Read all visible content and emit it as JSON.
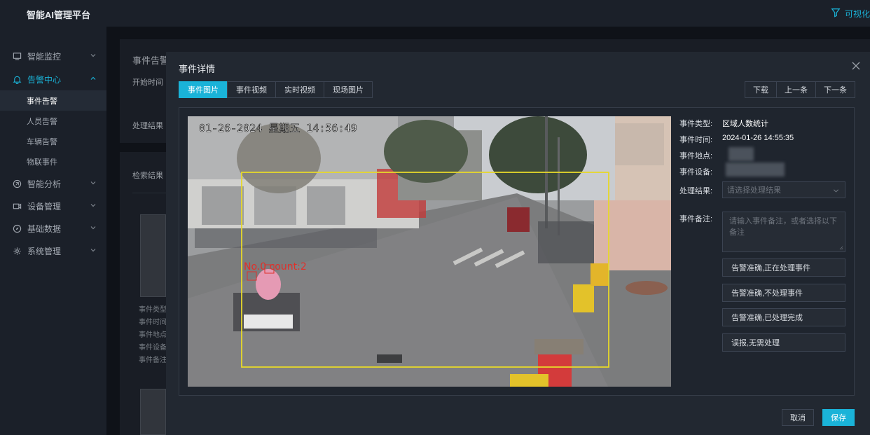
{
  "app": {
    "title": "智能AI管理平台",
    "top_right_label": "可视化"
  },
  "sidebar": {
    "items": [
      {
        "label": "智能监控",
        "icon": "monitor-icon"
      },
      {
        "label": "告警中心",
        "icon": "bell-icon"
      },
      {
        "label": "智能分析",
        "icon": "analysis-icon"
      },
      {
        "label": "设备管理",
        "icon": "camera-icon"
      },
      {
        "label": "基础数据",
        "icon": "compass-icon"
      },
      {
        "label": "系统管理",
        "icon": "gear-icon"
      }
    ],
    "sub_items": [
      "事件告警",
      "人员告警",
      "车辆告警",
      "物联事件"
    ]
  },
  "background": {
    "panel_title": "事件告警",
    "start_time_label": "开始时间",
    "result_label": "处理结果",
    "search_result_label": "检索结果",
    "card_fields": [
      "事件类型:",
      "事件时间:",
      "事件地点:",
      "事件设备:",
      "事件备注:"
    ]
  },
  "modal": {
    "title": "事件详情",
    "tabs": [
      "事件图片",
      "事件视频",
      "实时视频",
      "现场图片"
    ],
    "nav": {
      "download": "下载",
      "prev": "上一条",
      "next": "下一条"
    },
    "image": {
      "timestamp": "01-26-2024 星期五 14:56:49",
      "detection_label": "No.0 count:2"
    },
    "info": {
      "type_label": "事件类型:",
      "type_value": "区域人数统计",
      "time_label": "事件时间:",
      "time_value": "2024-01-26 14:55:35",
      "location_label": "事件地点:",
      "device_label": "事件设备:",
      "result_label": "处理结果:",
      "result_placeholder": "请选择处理结果",
      "remark_label": "事件备注:",
      "remark_placeholder": "请输入事件备注，或者选择以下备注"
    },
    "quick_remarks": [
      "告警准确,正在处理事件",
      "告警准确,不处理事件",
      "告警准确,已处理完成",
      "误报,无需处理"
    ],
    "footer": {
      "cancel": "取消",
      "save": "保存"
    }
  },
  "colors": {
    "accent": "#1ab3d8",
    "detection_box": "#e6d82a",
    "detection_text": "#e0302a"
  }
}
